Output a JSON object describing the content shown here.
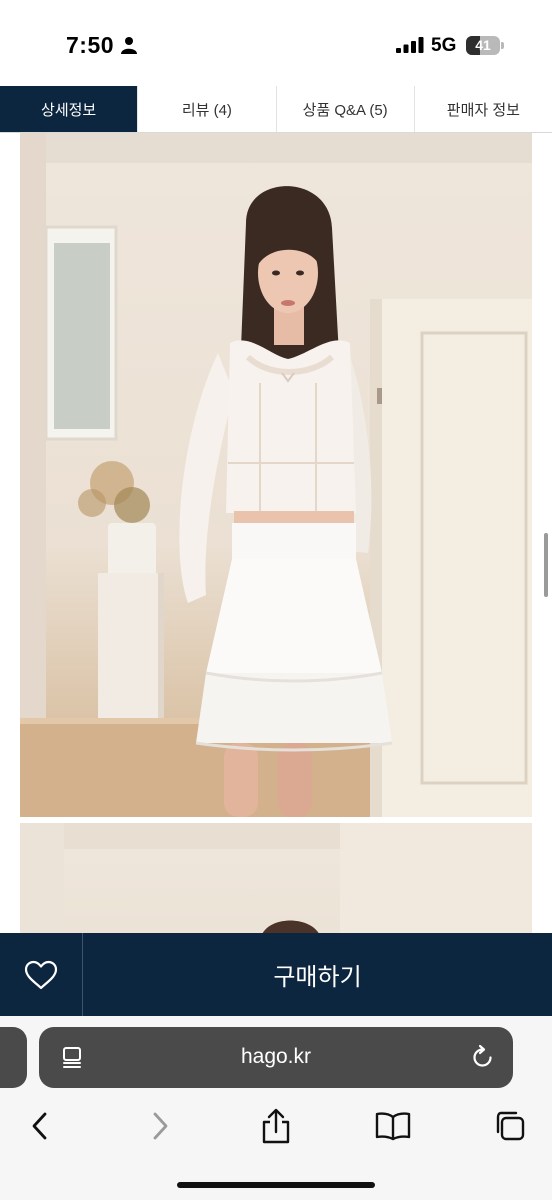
{
  "status_bar": {
    "time": "7:50",
    "network": "5G",
    "battery_level": "41",
    "battery_fraction": 0.41
  },
  "tabs": [
    {
      "label": "상세정보",
      "active": true
    },
    {
      "label": "리뷰 (4)",
      "active": false
    },
    {
      "label": "상품 Q&A (5)",
      "active": false
    },
    {
      "label": "판매자 정보",
      "active": false
    }
  ],
  "product_images": [
    "model-white-blouse-skirt-photo",
    "model-photo-2"
  ],
  "buy_bar": {
    "wishlist_icon": "heart-icon",
    "buy_label": "구매하기"
  },
  "browser": {
    "url": "hago.kr",
    "toolbar_icons": [
      "back-icon",
      "forward-icon",
      "share-icon",
      "bookmarks-icon",
      "tabs-icon"
    ]
  },
  "colors": {
    "accent_navy": "#0d2640",
    "scroll_button": "#1c1c1c",
    "url_bar": "#4a4a4a"
  }
}
